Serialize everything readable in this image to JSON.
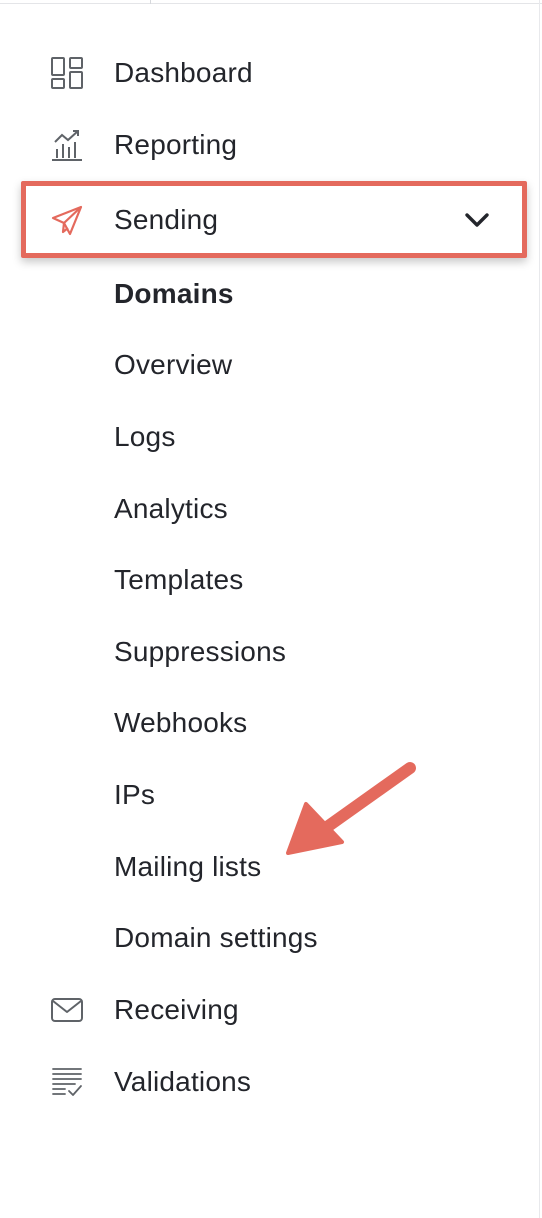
{
  "colors": {
    "accent": "#e46a5d",
    "text": "#23252b",
    "icon": "#5f6368"
  },
  "nav": {
    "items": [
      {
        "label": "Dashboard",
        "icon": "dashboard-grid-icon"
      },
      {
        "label": "Reporting",
        "icon": "chart-icon"
      },
      {
        "label": "Sending",
        "icon": "paper-plane-icon",
        "expanded": true,
        "chevron_icon": "chevron-down-icon"
      }
    ],
    "sending_subitems": [
      {
        "label": "Domains",
        "active": true
      },
      {
        "label": "Overview"
      },
      {
        "label": "Logs"
      },
      {
        "label": "Analytics"
      },
      {
        "label": "Templates"
      },
      {
        "label": "Suppressions"
      },
      {
        "label": "Webhooks"
      },
      {
        "label": "IPs"
      },
      {
        "label": "Mailing lists"
      },
      {
        "label": "Domain settings"
      }
    ],
    "bottom_items": [
      {
        "label": "Receiving",
        "icon": "envelope-icon"
      },
      {
        "label": "Validations",
        "icon": "list-check-icon"
      }
    ]
  },
  "annotation": {
    "arrow_icon": "pointer-arrow-icon"
  }
}
